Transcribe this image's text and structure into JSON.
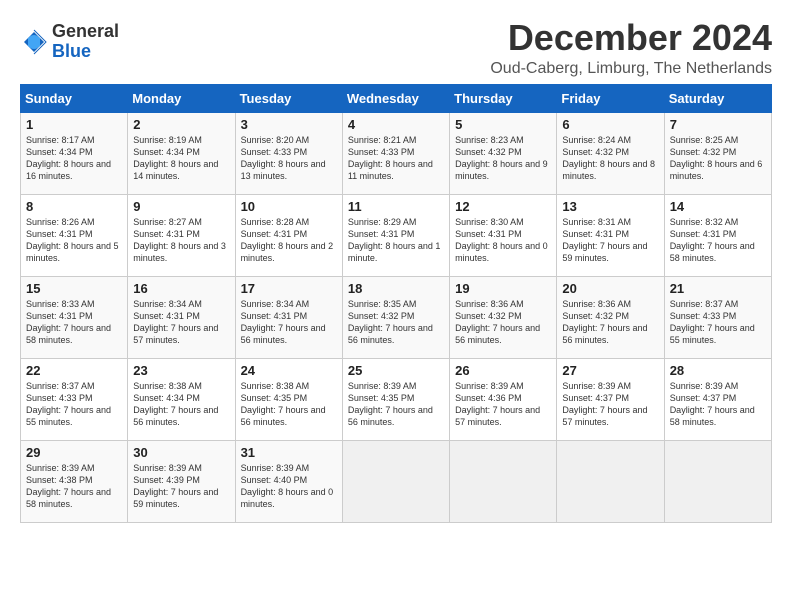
{
  "logo": {
    "general": "General",
    "blue": "Blue"
  },
  "title": "December 2024",
  "subtitle": "Oud-Caberg, Limburg, The Netherlands",
  "headers": [
    "Sunday",
    "Monday",
    "Tuesday",
    "Wednesday",
    "Thursday",
    "Friday",
    "Saturday"
  ],
  "weeks": [
    [
      {
        "day": "1",
        "rise": "8:17 AM",
        "set": "4:34 PM",
        "daylight": "8 hours and 16 minutes"
      },
      {
        "day": "2",
        "rise": "8:19 AM",
        "set": "4:34 PM",
        "daylight": "8 hours and 14 minutes"
      },
      {
        "day": "3",
        "rise": "8:20 AM",
        "set": "4:33 PM",
        "daylight": "8 hours and 13 minutes"
      },
      {
        "day": "4",
        "rise": "8:21 AM",
        "set": "4:33 PM",
        "daylight": "8 hours and 11 minutes"
      },
      {
        "day": "5",
        "rise": "8:23 AM",
        "set": "4:32 PM",
        "daylight": "8 hours and 9 minutes"
      },
      {
        "day": "6",
        "rise": "8:24 AM",
        "set": "4:32 PM",
        "daylight": "8 hours and 8 minutes"
      },
      {
        "day": "7",
        "rise": "8:25 AM",
        "set": "4:32 PM",
        "daylight": "8 hours and 6 minutes"
      }
    ],
    [
      {
        "day": "8",
        "rise": "8:26 AM",
        "set": "4:31 PM",
        "daylight": "8 hours and 5 minutes"
      },
      {
        "day": "9",
        "rise": "8:27 AM",
        "set": "4:31 PM",
        "daylight": "8 hours and 3 minutes"
      },
      {
        "day": "10",
        "rise": "8:28 AM",
        "set": "4:31 PM",
        "daylight": "8 hours and 2 minutes"
      },
      {
        "day": "11",
        "rise": "8:29 AM",
        "set": "4:31 PM",
        "daylight": "8 hours and 1 minute"
      },
      {
        "day": "12",
        "rise": "8:30 AM",
        "set": "4:31 PM",
        "daylight": "8 hours and 0 minutes"
      },
      {
        "day": "13",
        "rise": "8:31 AM",
        "set": "4:31 PM",
        "daylight": "7 hours and 59 minutes"
      },
      {
        "day": "14",
        "rise": "8:32 AM",
        "set": "4:31 PM",
        "daylight": "7 hours and 58 minutes"
      }
    ],
    [
      {
        "day": "15",
        "rise": "8:33 AM",
        "set": "4:31 PM",
        "daylight": "7 hours and 58 minutes"
      },
      {
        "day": "16",
        "rise": "8:34 AM",
        "set": "4:31 PM",
        "daylight": "7 hours and 57 minutes"
      },
      {
        "day": "17",
        "rise": "8:34 AM",
        "set": "4:31 PM",
        "daylight": "7 hours and 56 minutes"
      },
      {
        "day": "18",
        "rise": "8:35 AM",
        "set": "4:32 PM",
        "daylight": "7 hours and 56 minutes"
      },
      {
        "day": "19",
        "rise": "8:36 AM",
        "set": "4:32 PM",
        "daylight": "7 hours and 56 minutes"
      },
      {
        "day": "20",
        "rise": "8:36 AM",
        "set": "4:32 PM",
        "daylight": "7 hours and 56 minutes"
      },
      {
        "day": "21",
        "rise": "8:37 AM",
        "set": "4:33 PM",
        "daylight": "7 hours and 55 minutes"
      }
    ],
    [
      {
        "day": "22",
        "rise": "8:37 AM",
        "set": "4:33 PM",
        "daylight": "7 hours and 55 minutes"
      },
      {
        "day": "23",
        "rise": "8:38 AM",
        "set": "4:34 PM",
        "daylight": "7 hours and 56 minutes"
      },
      {
        "day": "24",
        "rise": "8:38 AM",
        "set": "4:35 PM",
        "daylight": "7 hours and 56 minutes"
      },
      {
        "day": "25",
        "rise": "8:39 AM",
        "set": "4:35 PM",
        "daylight": "7 hours and 56 minutes"
      },
      {
        "day": "26",
        "rise": "8:39 AM",
        "set": "4:36 PM",
        "daylight": "7 hours and 57 minutes"
      },
      {
        "day": "27",
        "rise": "8:39 AM",
        "set": "4:37 PM",
        "daylight": "7 hours and 57 minutes"
      },
      {
        "day": "28",
        "rise": "8:39 AM",
        "set": "4:37 PM",
        "daylight": "7 hours and 58 minutes"
      }
    ],
    [
      {
        "day": "29",
        "rise": "8:39 AM",
        "set": "4:38 PM",
        "daylight": "7 hours and 58 minutes"
      },
      {
        "day": "30",
        "rise": "8:39 AM",
        "set": "4:39 PM",
        "daylight": "7 hours and 59 minutes"
      },
      {
        "day": "31",
        "rise": "8:39 AM",
        "set": "4:40 PM",
        "daylight": "8 hours and 0 minutes"
      },
      null,
      null,
      null,
      null
    ]
  ]
}
